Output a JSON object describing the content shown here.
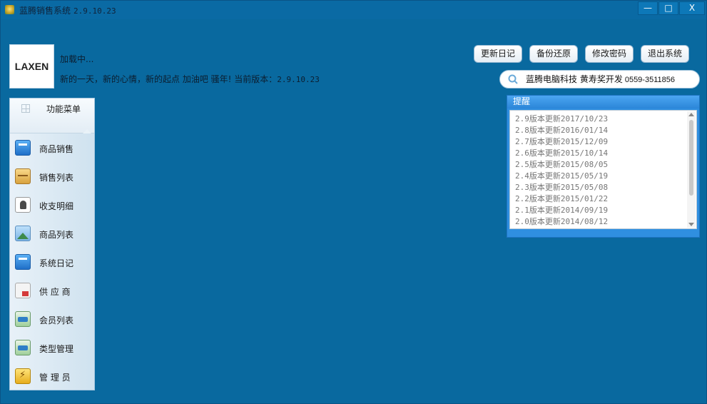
{
  "window": {
    "title": "蓝腾销售系统",
    "version": "2.9.10.23",
    "minimize_label": "—",
    "maximize_label": "□",
    "close_label": "X"
  },
  "logo": {
    "text": "LAXEN"
  },
  "status": {
    "loading": "加载中...",
    "welcome": "新的一天，新的心情，新的起点 加油吧 骚年! 当前版本：",
    "version": "2.9.10.23"
  },
  "toolbar": {
    "update_log": "更新日记",
    "backup_restore": "备份还原",
    "change_password": "修改密码",
    "exit_system": "退出系统"
  },
  "contact": {
    "company": "蓝腾电脑科技 黄寿奖开发",
    "phone": "0559-3511856",
    "icon": "search-icon"
  },
  "sidebar": {
    "title": "功能菜单",
    "items": [
      {
        "label": "商品销售",
        "icon": "sales-icon"
      },
      {
        "label": "销售列表",
        "icon": "box-icon"
      },
      {
        "label": "收支明细",
        "icon": "person-icon"
      },
      {
        "label": "商品列表",
        "icon": "image-icon"
      },
      {
        "label": "系统日记",
        "icon": "log-icon"
      },
      {
        "label": "供 应 商",
        "icon": "supplier-icon"
      },
      {
        "label": "会员列表",
        "icon": "member-icon"
      },
      {
        "label": "类型管理",
        "icon": "category-icon"
      },
      {
        "label": "管 理 员",
        "icon": "admin-icon"
      }
    ]
  },
  "reminder": {
    "title": "提醒",
    "items": [
      "2.9版本更新2017/10/23",
      "2.8版本更新2016/01/14",
      "2.7版本更新2015/12/09",
      "2.6版本更新2015/10/14",
      "2.5版本更新2015/08/05",
      "2.4版本更新2015/05/19",
      "2.3版本更新2015/05/08",
      "2.2版本更新2015/01/22",
      "2.1版本更新2014/09/19",
      "2.0版本更新2014/08/12"
    ]
  },
  "colors": {
    "background": "#09699f",
    "panel_header": "#2f8fe0",
    "sidebar": "#d6e7f2"
  }
}
